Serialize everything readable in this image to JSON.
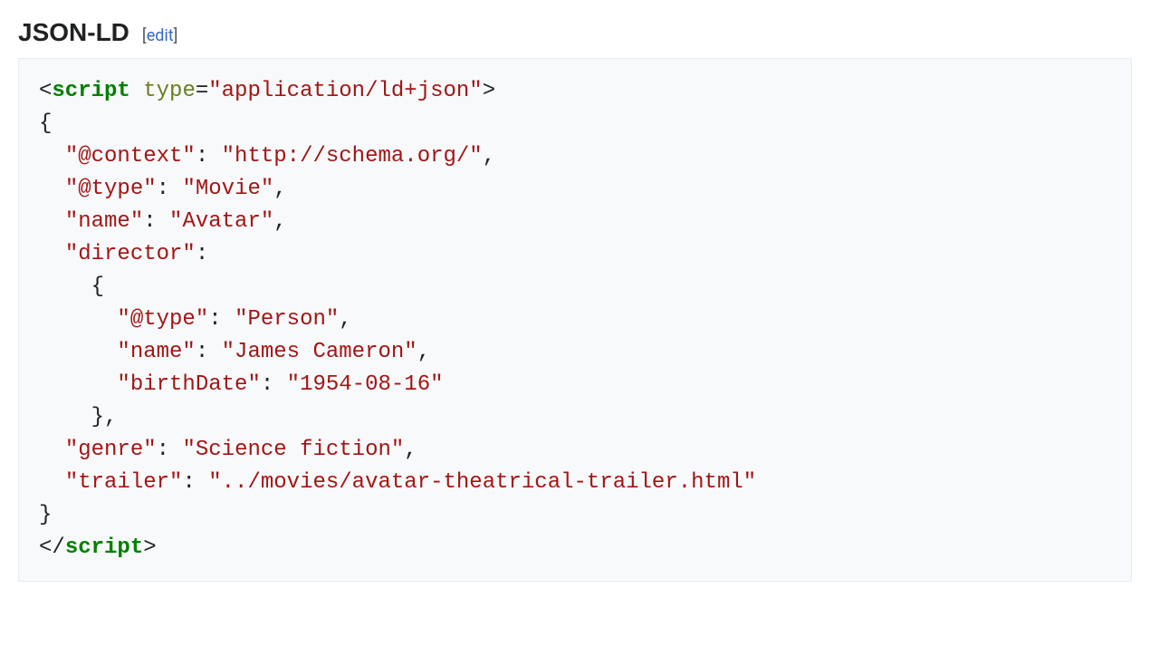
{
  "heading": "JSON-LD",
  "editOpen": "[",
  "editLabel": "edit",
  "editClose": "]",
  "code": {
    "l1_open_angle": "<",
    "l1_tag": "script",
    "l1_space": " ",
    "l1_attr": "type",
    "l1_eq": "=",
    "l1_val": "\"application/ld+json\"",
    "l1_close_angle": ">",
    "l2": "{",
    "l3_indent": "  ",
    "l3_key": "\"@context\"",
    "l3_colon": ": ",
    "l3_val": "\"http://schema.org/\"",
    "l3_comma": ",",
    "l4_indent": "  ",
    "l4_key": "\"@type\"",
    "l4_colon": ": ",
    "l4_val": "\"Movie\"",
    "l4_comma": ",",
    "l5_indent": "  ",
    "l5_key": "\"name\"",
    "l5_colon": ": ",
    "l5_val": "\"Avatar\"",
    "l5_comma": ",",
    "l6_indent": "  ",
    "l6_key": "\"director\"",
    "l6_colon": ":",
    "l7": "    {",
    "l8_indent": "      ",
    "l8_key": "\"@type\"",
    "l8_colon": ": ",
    "l8_val": "\"Person\"",
    "l8_comma": ",",
    "l9_indent": "      ",
    "l9_key": "\"name\"",
    "l9_colon": ": ",
    "l9_val": "\"James Cameron\"",
    "l9_comma": ",",
    "l10_indent": "      ",
    "l10_key": "\"birthDate\"",
    "l10_colon": ": ",
    "l10_val": "\"1954-08-16\"",
    "l11": "    },",
    "l12_indent": "  ",
    "l12_key": "\"genre\"",
    "l12_colon": ": ",
    "l12_val": "\"Science fiction\"",
    "l12_comma": ",",
    "l13_indent": "  ",
    "l13_key": "\"trailer\"",
    "l13_colon": ": ",
    "l13_val": "\"../movies/avatar-theatrical-trailer.html\"",
    "l14": "}",
    "l15_open": "</",
    "l15_tag": "script",
    "l15_close": ">"
  }
}
